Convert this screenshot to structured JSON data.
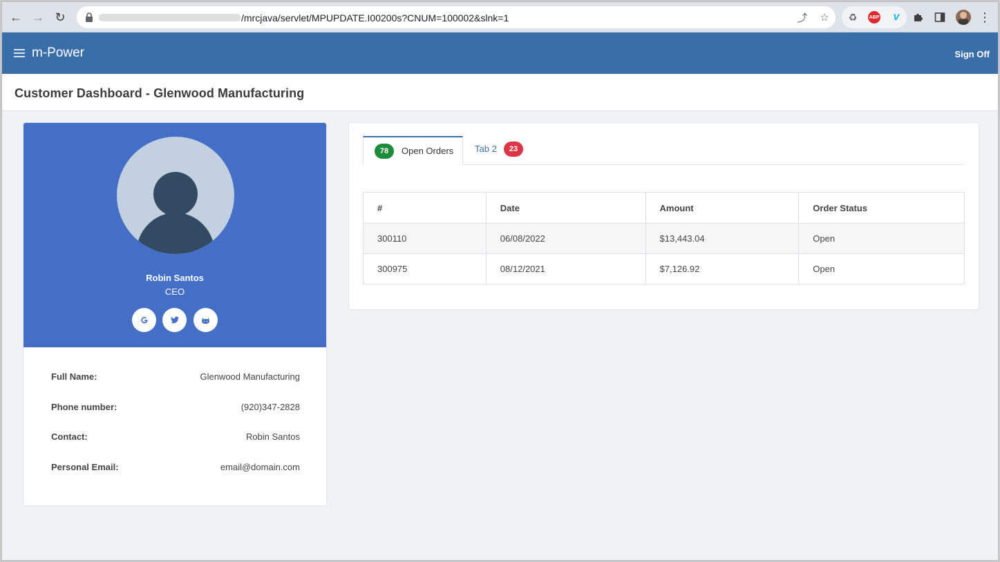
{
  "browser": {
    "url": "/mrcjava/servlet/MPUPDATE.I00200s?CNUM=100002&slnk=1",
    "ext_abp": "ABP"
  },
  "app": {
    "brand": "m-Power",
    "signoff": "Sign Off"
  },
  "page": {
    "title": "Customer Dashboard - Glenwood Manufacturing"
  },
  "profile": {
    "name": "Robin Santos",
    "role": "CEO",
    "social": [
      {
        "icon": "google-icon",
        "glyph": "G"
      },
      {
        "icon": "twitter-icon",
        "glyph": "t"
      },
      {
        "icon": "github-icon",
        "glyph": "gh"
      }
    ],
    "fields": [
      {
        "label": "Full Name:",
        "value": "Glenwood Manufacturing"
      },
      {
        "label": "Phone number:",
        "value": "(920)347-2828"
      },
      {
        "label": "Contact:",
        "value": "Robin Santos"
      },
      {
        "label": "Personal Email:",
        "value": "email@domain.com"
      }
    ]
  },
  "tabs": [
    {
      "label": "Open Orders",
      "badge": "78",
      "badge_color": "#1e8b3b",
      "active": true
    },
    {
      "label": "Tab 2",
      "badge": "23",
      "badge_color": "#dc3545",
      "active": false
    }
  ],
  "orders_table": {
    "columns": [
      "#",
      "Date",
      "Amount",
      "Order Status"
    ],
    "rows": [
      [
        "300110",
        "06/08/2022",
        "$13,443.04",
        "Open"
      ],
      [
        "300975",
        "08/12/2021",
        "$7,126.92",
        "Open"
      ]
    ]
  },
  "colors": {
    "header": "#3a6ea8",
    "profile_bg": "#436fc6",
    "active_tab_link": "#3a6ea8"
  }
}
